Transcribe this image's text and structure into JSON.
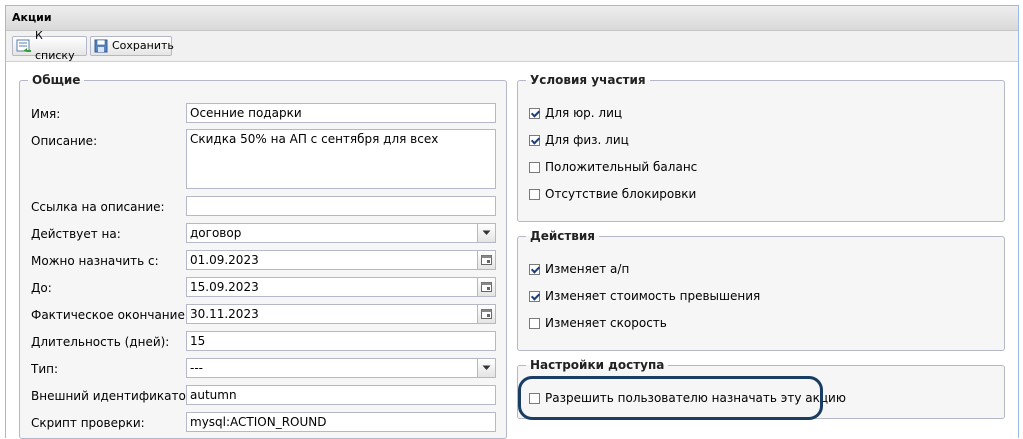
{
  "panel": {
    "title": "Акции"
  },
  "toolbar": {
    "back_label": "К списку",
    "save_label": "Сохранить"
  },
  "general": {
    "legend": "Общие",
    "name": {
      "label": "Имя:",
      "value": "Осенние подарки"
    },
    "description": {
      "label": "Описание:",
      "value": "Скидка 50% на АП с сентября для всех"
    },
    "link": {
      "label": "Ссылка на описание:",
      "value": ""
    },
    "applies_to": {
      "label": "Действует на:",
      "value": "договор"
    },
    "assign_from": {
      "label": "Можно назначить с:",
      "value": "01.09.2023"
    },
    "until": {
      "label": "До:",
      "value": "15.09.2023"
    },
    "actual_end": {
      "label": "Фактическое окончание:",
      "value": "30.11.2023"
    },
    "duration": {
      "label": "Длительность (дней):",
      "value": "15"
    },
    "type": {
      "label": "Тип:",
      "value": "---"
    },
    "external_id": {
      "label": "Внешний идентификатор:",
      "value": "autumn"
    },
    "check_script": {
      "label": "Скрипт проверки:",
      "value": "mysql:ACTION_ROUND"
    }
  },
  "conditions": {
    "legend": "Условия участия",
    "items": [
      {
        "label": "Для юр. лиц",
        "checked": true
      },
      {
        "label": "Для физ. лиц",
        "checked": true
      },
      {
        "label": "Положительный баланс",
        "checked": false
      },
      {
        "label": "Отсутствие блокировки",
        "checked": false
      }
    ]
  },
  "actions": {
    "legend": "Действия",
    "items": [
      {
        "label": "Изменяет а/п",
        "checked": true
      },
      {
        "label": "Изменяет стоимость превышения",
        "checked": true
      },
      {
        "label": "Изменяет скорость",
        "checked": false
      }
    ]
  },
  "access": {
    "legend": "Настройки доступа",
    "items": [
      {
        "label": "Разрешить пользователю назначать эту акцию",
        "checked": false
      }
    ]
  },
  "colors": {
    "header_text": "#15428b",
    "highlight_border": "#1a3d63",
    "field_border": "#b5b8c8"
  }
}
